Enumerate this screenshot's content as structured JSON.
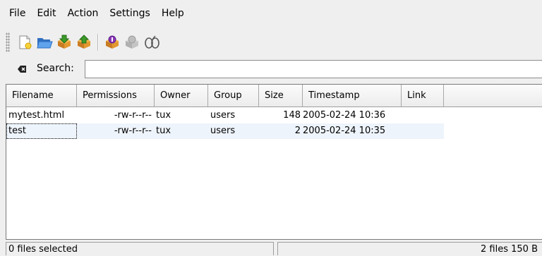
{
  "menubar": {
    "items": [
      {
        "label": "File"
      },
      {
        "label": "Edit"
      },
      {
        "label": "Action"
      },
      {
        "label": "Settings"
      },
      {
        "label": "Help"
      }
    ]
  },
  "toolbar": {
    "icons": [
      "new-archive-icon",
      "open-archive-icon",
      "extract-icon",
      "add-files-icon",
      "view-icon",
      "open-with-icon",
      "find-icon"
    ]
  },
  "search": {
    "label": "Search:",
    "value": "",
    "placeholder": ""
  },
  "table": {
    "columns": [
      "Filename",
      "Permissions",
      "Owner",
      "Group",
      "Size",
      "Timestamp",
      "Link"
    ],
    "rows": [
      {
        "filename": "mytest.html",
        "permissions": "-rw-r--r--",
        "owner": "tux",
        "group": "users",
        "size": "148",
        "timestamp": "2005-02-24 10:36",
        "link": ""
      },
      {
        "filename": "test",
        "permissions": "-rw-r--r--",
        "owner": "tux",
        "group": "users",
        "size": "2",
        "timestamp": "2005-02-24 10:35",
        "link": ""
      }
    ]
  },
  "status": {
    "selected": "0 files selected",
    "summary": "2 files  150 B"
  },
  "colors": {
    "background": "#efefef",
    "alt_row": "#eef4fb",
    "folder_blue": "#3f86d6",
    "box_green": "#3c9a2a",
    "box_purple": "#8a37b8"
  }
}
